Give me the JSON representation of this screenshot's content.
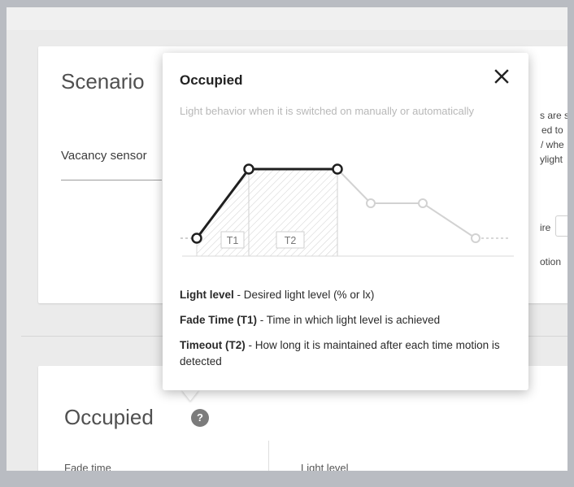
{
  "scenario": {
    "title": "Scenario",
    "vacancy_label": "Vacancy sensor",
    "right_text": [
      "s are s",
      "ed to",
      "/ whe",
      "ylight"
    ],
    "right_labels": [
      "ire",
      "otion"
    ]
  },
  "occupied_card": {
    "title": "Occupied",
    "help_glyph": "?",
    "fade_label": "Fade time",
    "light_label": "Light level"
  },
  "popover": {
    "title": "Occupied",
    "subtitle": "Light behavior when it is switched on manually or automatically",
    "diagram": {
      "t1": "T1",
      "t2": "T2"
    },
    "legend": [
      {
        "term": "Light level",
        "desc": " - Desired light level (% or lx)"
      },
      {
        "term": "Fade Time (T1)",
        "desc": " - Time in which light level is achieved"
      },
      {
        "term": "Timeout (T2)",
        "desc": " - How long it is maintained after each time motion is detected"
      }
    ]
  },
  "colors": {
    "background": "#b9bcc2",
    "card": "#ffffff",
    "active_line": "#1f1f1f",
    "inactive_line": "#d2d2d2",
    "subtitle": "#b8b8b8",
    "help_icon": "#7b7b7b"
  },
  "icons": {
    "close": "close-icon",
    "help": "help-icon"
  }
}
